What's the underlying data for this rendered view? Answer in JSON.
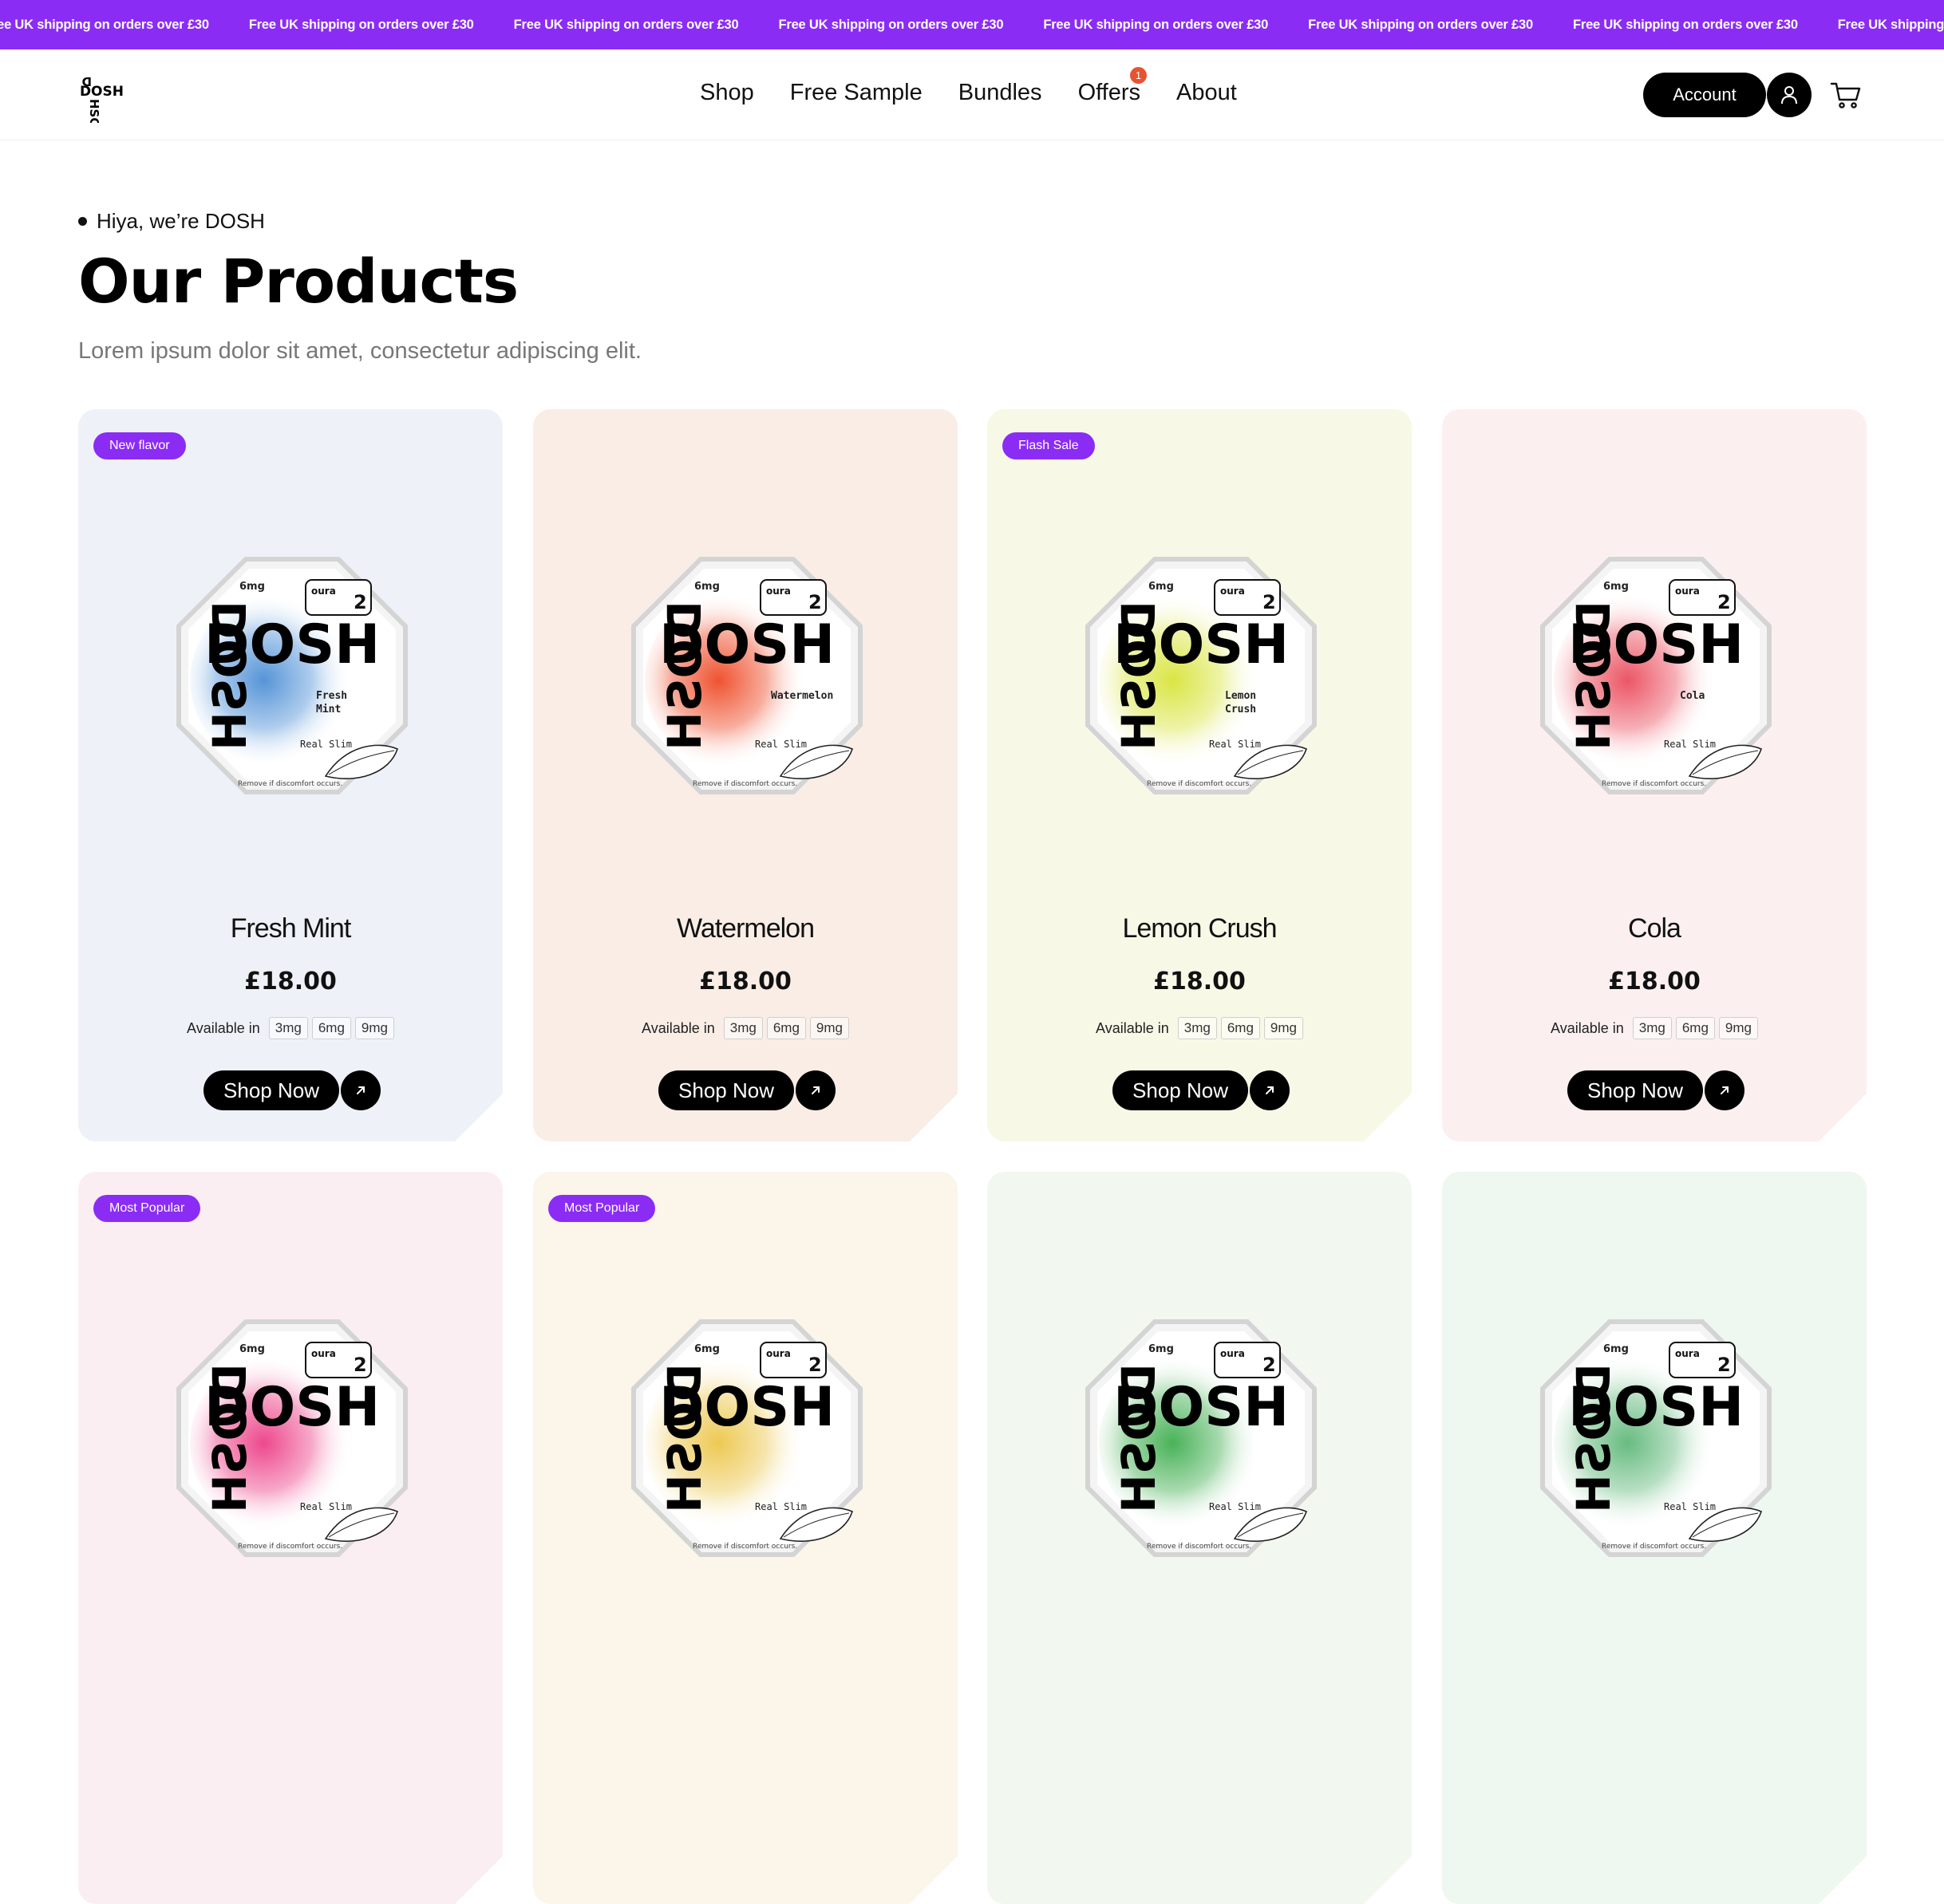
{
  "announcement": {
    "text": "Free UK shipping on orders over £30"
  },
  "header": {
    "logo_text": "DOSH",
    "nav": [
      {
        "label": "Shop"
      },
      {
        "label": "Free Sample"
      },
      {
        "label": "Bundles"
      },
      {
        "label": "Offers",
        "badge": "1"
      },
      {
        "label": "About"
      }
    ],
    "account_label": "Account",
    "icons": {
      "user": "user-icon",
      "cart": "cart-icon"
    }
  },
  "hero": {
    "eyebrow": "Hiya, we’re DOSH",
    "title": "Our Products",
    "subtitle": "Lorem ipsum dolor sit amet, consectetur adipiscing elit."
  },
  "colors": {
    "brand_purple": "#8b2cf5",
    "notification": "#e8532f",
    "black": "#000000"
  },
  "products": [
    {
      "name": "Fresh Mint",
      "price": "£18.00",
      "badge": "New flavor",
      "bg": "#eef2f8",
      "glow": "#4d8fd6",
      "pack_flavor": "Fresh Mint",
      "strength": "6mg"
    },
    {
      "name": "Watermelon",
      "price": "£18.00",
      "badge": "",
      "bg": "#f9ede6",
      "glow": "#ee4a26",
      "pack_flavor": "Watermelon",
      "strength": "6mg"
    },
    {
      "name": "Lemon Crush",
      "price": "£18.00",
      "badge": "Flash Sale",
      "bg": "#f8f8e7",
      "glow": "#d8e43a",
      "pack_flavor": "Lemon Crush",
      "strength": "6mg"
    },
    {
      "name": "Cola",
      "price": "£18.00",
      "badge": "",
      "bg": "#fbf0ef",
      "glow": "#ea4d5d",
      "pack_flavor": "Cola",
      "strength": "6mg"
    },
    {
      "name": "",
      "price": "",
      "badge": "Most Popular",
      "bg": "#fbeef3",
      "glow": "#ec3f86",
      "pack_flavor": "",
      "strength": "6mg"
    },
    {
      "name": "",
      "price": "",
      "badge": "Most Popular",
      "bg": "#fbf5ea",
      "glow": "#ecc64a",
      "pack_flavor": "",
      "strength": "6mg"
    },
    {
      "name": "",
      "price": "",
      "badge": "",
      "bg": "#f2f8ef",
      "glow": "#3fae4f",
      "pack_flavor": "",
      "strength": "6mg"
    },
    {
      "name": "",
      "price": "",
      "badge": "",
      "bg": "#eef7f0",
      "glow": "#60b87a",
      "pack_flavor": "",
      "strength": "6mg"
    }
  ],
  "availability": {
    "label": "Available in",
    "options": [
      "3mg",
      "6mg",
      "9mg"
    ]
  },
  "cta": {
    "shop_now": "Shop Now"
  }
}
